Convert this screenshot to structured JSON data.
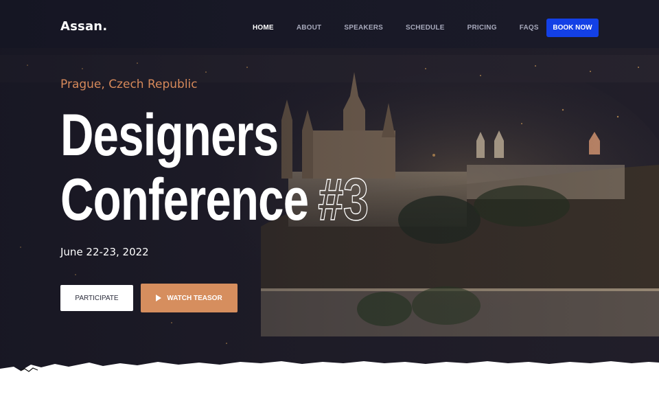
{
  "brand": {
    "logo": "Assan."
  },
  "nav": {
    "items": [
      {
        "label": "HOME",
        "active": true
      },
      {
        "label": "ABOUT",
        "active": false
      },
      {
        "label": "SPEAKERS",
        "active": false
      },
      {
        "label": "SCHEDULE",
        "active": false
      },
      {
        "label": "PRICING",
        "active": false
      },
      {
        "label": "FAQS",
        "active": false
      }
    ],
    "cta": "BOOK NOW"
  },
  "hero": {
    "location": "Prague, Czech Republic",
    "title_line1": "Designers",
    "title_line2": "Conference",
    "title_number": "#3",
    "date": "June 22-23, 2022",
    "primary_button": "PARTICIPATE",
    "secondary_button": "WATCH TEASOR",
    "secondary_icon": "play-icon"
  },
  "colors": {
    "accent": "#d68e5e",
    "cta": "#1340e6",
    "hero_bg": "#1a1b2b"
  }
}
